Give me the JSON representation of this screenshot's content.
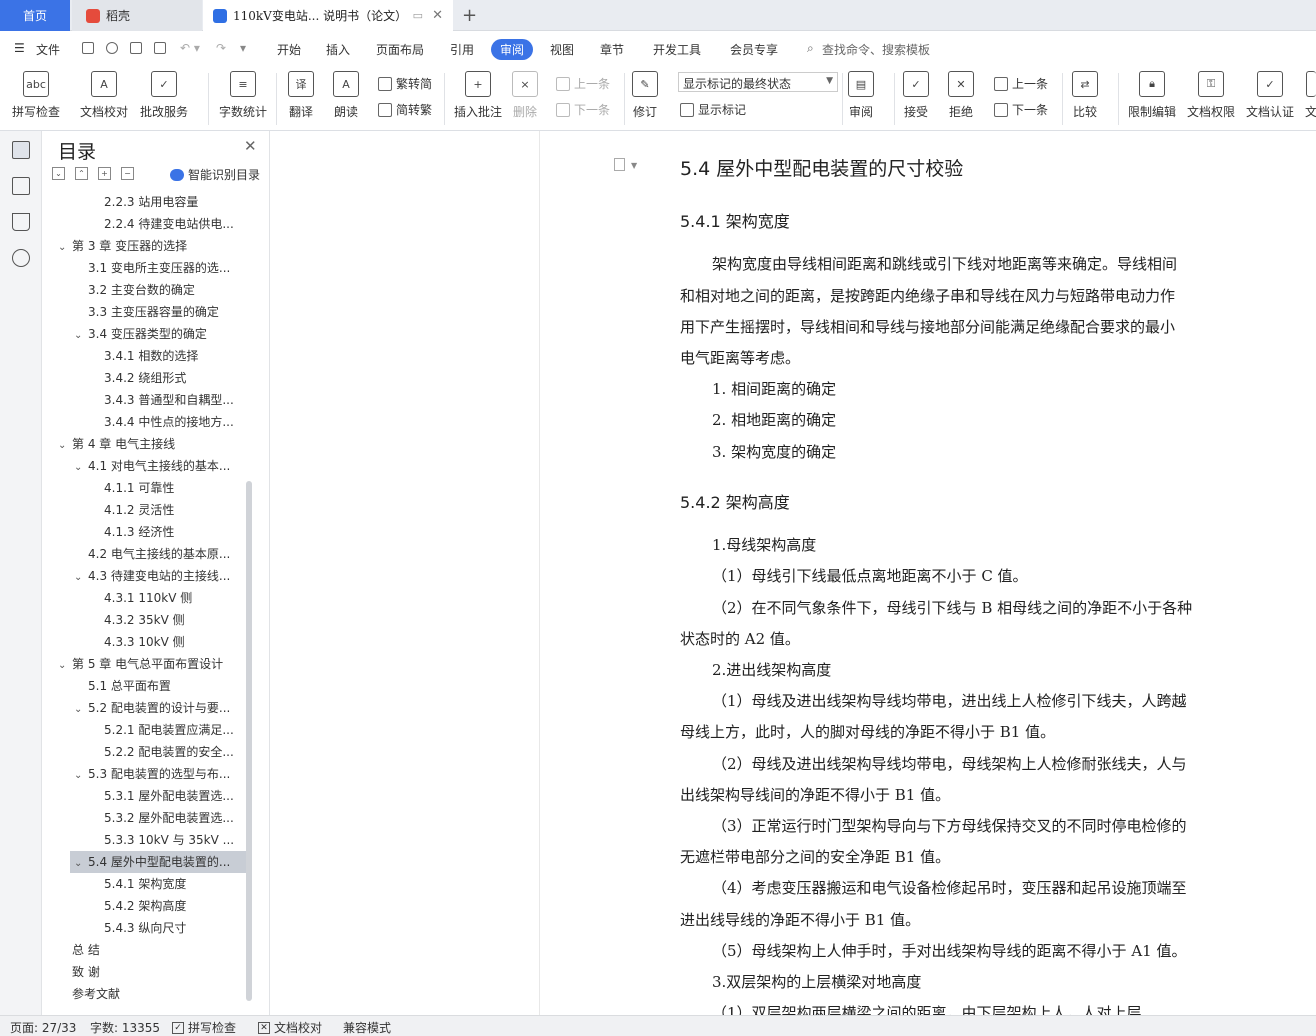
{
  "tabs": {
    "home": "首页",
    "daoke": "稻壳",
    "doc": "110kV变电站... 说明书（论文）"
  },
  "menu": {
    "file": "文件",
    "items": [
      "开始",
      "插入",
      "页面布局",
      "引用",
      "审阅",
      "视图",
      "章节",
      "开发工具",
      "会员专享"
    ],
    "active": "审阅",
    "search": "查找命令、搜索模板"
  },
  "ribbon": {
    "spell": "拼写检查",
    "doccheck": "文档校对",
    "batch": "批改服务",
    "wordcount": "字数统计",
    "translate": "翻译",
    "read": "朗读",
    "trad2simp": "繁转简",
    "simp2trad": "简转繁",
    "insert_comment": "插入批注",
    "delete": "删除",
    "prev_comment": "上一条",
    "next_comment": "下一条",
    "track": "修订",
    "markup_state": "显示标记的最终状态",
    "show_markup": "显示标记",
    "review": "审阅",
    "accept": "接受",
    "reject": "拒绝",
    "prev": "上一条",
    "next": "下一条",
    "compare": "比较",
    "restrict": "限制编辑",
    "permission": "文档权限",
    "certify": "文档认证",
    "more": "文"
  },
  "toc": {
    "title": "目录",
    "smart": "智能识别目录",
    "items": [
      {
        "text": "2.2.3  站用电容量",
        "level": 3,
        "chev": ""
      },
      {
        "text": "2.2.4  待建变电站供电...",
        "level": 3,
        "chev": ""
      },
      {
        "text": "第 3 章  变压器的选择",
        "level": 1,
        "chev": "v"
      },
      {
        "text": "3.1 变电所主变压器的选...",
        "level": 2,
        "chev": ""
      },
      {
        "text": "3.2 主变台数的确定",
        "level": 2,
        "chev": ""
      },
      {
        "text": "3.3 主变压器容量的确定",
        "level": 2,
        "chev": ""
      },
      {
        "text": "3.4  变压器类型的确定",
        "level": 2,
        "chev": "v"
      },
      {
        "text": "3.4.1 相数的选择",
        "level": 3,
        "chev": ""
      },
      {
        "text": "3.4.2  绕组形式",
        "level": 3,
        "chev": ""
      },
      {
        "text": "3.4.3  普通型和自耦型...",
        "level": 3,
        "chev": ""
      },
      {
        "text": "3.4.4  中性点的接地方...",
        "level": 3,
        "chev": ""
      },
      {
        "text": "第 4 章  电气主接线",
        "level": 1,
        "chev": "v"
      },
      {
        "text": "4.1 对电气主接线的基本...",
        "level": 2,
        "chev": "v"
      },
      {
        "text": "4.1.1 可靠性",
        "level": 3,
        "chev": ""
      },
      {
        "text": "4.1.2 灵活性",
        "level": 3,
        "chev": ""
      },
      {
        "text": "4.1.3 经济性",
        "level": 3,
        "chev": ""
      },
      {
        "text": "4.2 电气主接线的基本原...",
        "level": 2,
        "chev": ""
      },
      {
        "text": "4.3 待建变电站的主接线...",
        "level": 2,
        "chev": "v"
      },
      {
        "text": "4.3.1 110kV 侧",
        "level": 3,
        "chev": ""
      },
      {
        "text": "4.3.2 35kV 侧",
        "level": 3,
        "chev": ""
      },
      {
        "text": "4.3.3 10kV 侧",
        "level": 3,
        "chev": ""
      },
      {
        "text": "第 5 章  电气总平面布置设计",
        "level": 1,
        "chev": "v"
      },
      {
        "text": "5.1 总平面布置",
        "level": 2,
        "chev": ""
      },
      {
        "text": "5.2 配电装置的设计与要...",
        "level": 2,
        "chev": "v"
      },
      {
        "text": "5.2.1  配电装置应满足...",
        "level": 3,
        "chev": ""
      },
      {
        "text": "5.2.2  配电装置的安全...",
        "level": 3,
        "chev": ""
      },
      {
        "text": "5.3  配电装置的选型与布...",
        "level": 2,
        "chev": "v"
      },
      {
        "text": "5.3.1  屋外配电装置选...",
        "level": 3,
        "chev": ""
      },
      {
        "text": "5.3.2  屋外配电装置选...",
        "level": 3,
        "chev": ""
      },
      {
        "text": "5.3.3 10kV 与 35kV ...",
        "level": 3,
        "chev": ""
      },
      {
        "text": "5.4 屋外中型配电装置的...",
        "level": 2,
        "chev": "v",
        "selected": true
      },
      {
        "text": "5.4.1 架构宽度",
        "level": 3,
        "chev": ""
      },
      {
        "text": "5.4.2 架构高度",
        "level": 3,
        "chev": ""
      },
      {
        "text": "5.4.3 纵向尺寸",
        "level": 3,
        "chev": ""
      },
      {
        "text": "总    结",
        "level": 1,
        "chev": ""
      },
      {
        "text": "致    谢",
        "level": 1,
        "chev": ""
      },
      {
        "text": "参考文献",
        "level": 1,
        "chev": ""
      }
    ]
  },
  "doc": {
    "h_54": "5.4 屋外中型配电装置的尺寸校验",
    "h_541": "5.4.1 架构宽度",
    "p1_l1": "架构宽度由导线相间距离和跳线或引下线对地距离等来确定。导线相间",
    "p1_l2": "和相对地之间的距离，是按跨距内绝缘子串和导线在风力与短路带电动力作",
    "p1_l3": "用下产生摇摆时，导线相间和导线与接地部分间能满足绝缘配合要求的最小",
    "p1_l4": "电气距离等考虑。",
    "li1": "1.   相间距离的确定",
    "li2": "2.   相地距离的确定",
    "li3": "3.   架构宽度的确定",
    "h_542": "5.4.2 架构高度",
    "s1": "1.母线架构高度",
    "s1_1": "（1）母线引下线最低点离地距离不小于 C 值。",
    "s1_2a": "（2）在不同气象条件下，母线引下线与 B 相母线之间的净距不小于各种",
    "s1_2b": "状态时的 A2 值。",
    "s2": "2.进出线架构高度",
    "s2_1a": "（1）母线及进出线架构导线均带电，进出线上人检修引下线夫，人跨越",
    "s2_1b": "母线上方，此时，人的脚对母线的净距不得小于 B1 值。",
    "s2_2a": "（2）母线及进出线架构导线均带电，母线架构上人检修耐张线夫，人与",
    "s2_2b": "出线架构导线间的净距不得小于 B1 值。",
    "s2_3a": "（3）正常运行时门型架构导向与下方母线保持交叉的不同时停电检修的",
    "s2_3b": "无遮栏带电部分之间的安全净距 B1 值。",
    "s2_4a": "（4）考虑变压器搬运和电气设备检修起吊时，变压器和起吊设施顶端至",
    "s2_4b": "进出线导线的净距不得小于 B1 值。",
    "s2_5": "（5）母线架构上人伸手时，手对出线架构导线的距离不得小于 A1 值。",
    "s3": "3.双层架构的上层横梁对地高度",
    "s3_1": "（1）双层架构两层横梁之间的距离，由下层架构上人，人对上层"
  },
  "status": {
    "page": "页面: 27/33",
    "words": "字数: 13355",
    "spell": "拼写检查",
    "doccheck": "文档校对",
    "compat": "兼容模式"
  }
}
